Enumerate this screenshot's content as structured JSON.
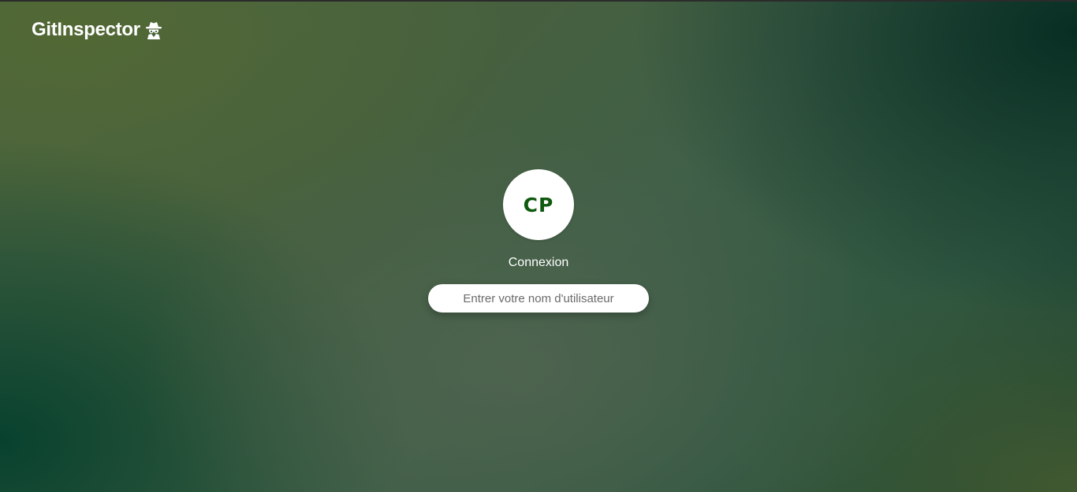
{
  "header": {
    "app_title": "GitInspector",
    "app_icon": "spy-icon"
  },
  "login": {
    "avatar_initials": "CP",
    "title": "Connexion",
    "username_placeholder": "Entrer votre nom d'utilisateur",
    "username_value": ""
  },
  "colors": {
    "avatar_text": "#0f5a0f",
    "text": "#ffffff",
    "input_background": "#ffffff"
  }
}
